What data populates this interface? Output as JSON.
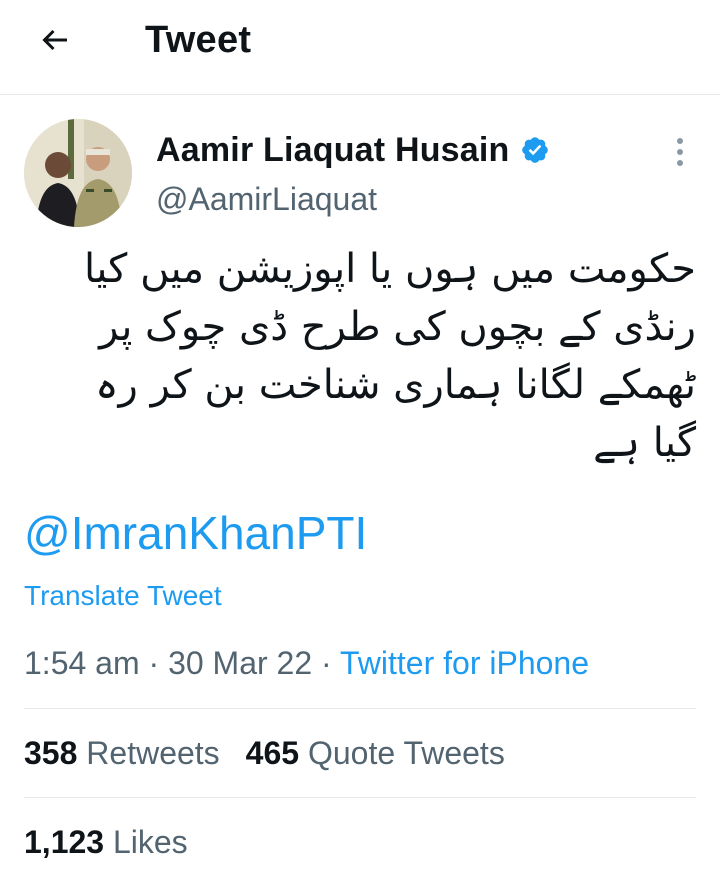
{
  "header": {
    "title": "Tweet",
    "back_icon": "arrow-left-icon"
  },
  "author": {
    "name": "Aamir Liaquat Husain",
    "handle": "@AamirLiaquat",
    "verified_color": "#1d9bf0"
  },
  "tweet": {
    "lines": [
      "حکومت میں ہوں یا اپوزیشن میں کیا",
      "رنڈی کے بچوں کی طرح ڈی چوک پر",
      "ٹھمکے لگانا ہماری شناخت بن کر رہ",
      "گیا ہے"
    ],
    "mention": "@ImranKhanPTI",
    "translate_label": "Translate Tweet"
  },
  "meta": {
    "time": "1:54 am",
    "separator": "·",
    "date": "30 Mar 22",
    "source": "Twitter for iPhone"
  },
  "stats": {
    "retweets_count": "358",
    "retweets_label": "Retweets",
    "quotes_count": "465",
    "quotes_label": "Quote Tweets",
    "likes_count": "1,123",
    "likes_label": "Likes"
  },
  "colors": {
    "accent": "#1d9bf0",
    "muted": "#536471",
    "text": "#0f1419",
    "divider": "#e6e9ec"
  }
}
